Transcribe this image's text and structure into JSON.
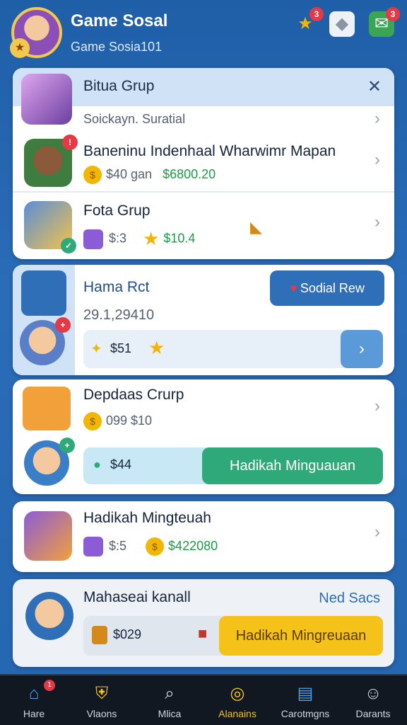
{
  "header": {
    "title": "Game Sosal",
    "subtitle": "Game Sosia101",
    "star_count": "3",
    "mail_count": "3"
  },
  "card1": {
    "title": "Bitua Grup",
    "row0_sub": "Soickayn. Suratial",
    "row1_title": "Baneninu Indenhaal Wharwimr Mapan",
    "row1_coin": "$40 gan",
    "row1_money": "$6800.20",
    "row2_title": "Fota Grup",
    "row2_a": "$:3",
    "row2_money": "$10.4"
  },
  "card2": {
    "title": "Hama Rct",
    "button": "Sodial Rew",
    "number": "29.1,29410",
    "bar_value": "$51"
  },
  "card3": {
    "title": "Depdaas Crurp",
    "sub": "099 $10",
    "bar_value": "$44",
    "button": "Hadikah Minguauan"
  },
  "card4": {
    "title": "Hadikah Mingteuah",
    "a": "$:5",
    "money": "$422080"
  },
  "card5": {
    "title": "Mahaseai kanall",
    "link": "Ned Sacs",
    "bar_value": "$029",
    "button": "Hadikah Mingreuaan"
  },
  "nav": [
    {
      "label": "Hare",
      "icon": "home-icon"
    },
    {
      "label": "Vlaons",
      "icon": "shield-icon"
    },
    {
      "label": "Mlica",
      "icon": "search-icon"
    },
    {
      "label": "Alanains",
      "icon": "compass-icon"
    },
    {
      "label": "Carotmgns",
      "icon": "chat-icon"
    },
    {
      "label": "Darants",
      "icon": "profile-icon"
    }
  ],
  "nav_badge": "1"
}
